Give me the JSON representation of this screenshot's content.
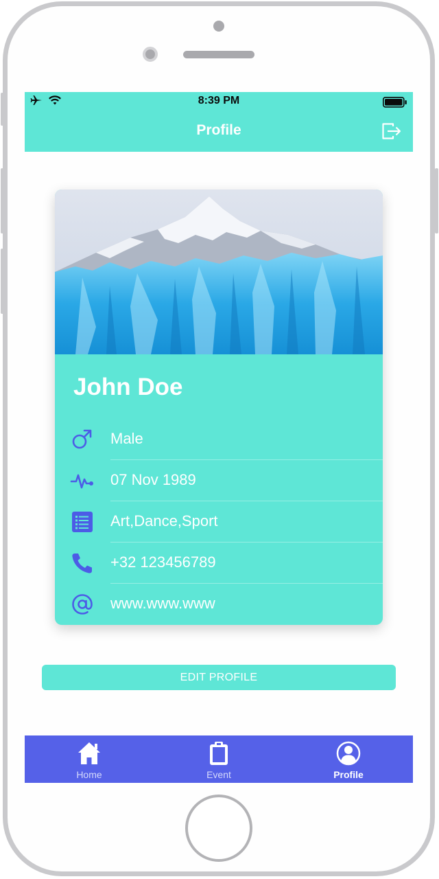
{
  "status_bar": {
    "time": "8:39 PM"
  },
  "header": {
    "title": "Profile",
    "logout_icon": "logout-icon"
  },
  "profile": {
    "name": "John Doe",
    "cover_image": "glacier-mountain-photo",
    "details": [
      {
        "icon": "male-icon",
        "value": "Male"
      },
      {
        "icon": "heartbeat-icon",
        "value": "07 Nov 1989"
      },
      {
        "icon": "list-icon",
        "value": "Art,Dance,Sport"
      },
      {
        "icon": "phone-icon",
        "value": "+32 123456789"
      },
      {
        "icon": "at-icon",
        "value": "www.www.www"
      }
    ]
  },
  "edit_button": {
    "label": "EDIT PROFILE"
  },
  "tab_bar": {
    "tabs": [
      {
        "label": "Home",
        "icon": "home-icon",
        "active": false
      },
      {
        "label": "Event",
        "icon": "clipboard-icon",
        "active": false
      },
      {
        "label": "Profile",
        "icon": "profile-icon",
        "active": true
      }
    ]
  },
  "colors": {
    "accent": "#5ee6d6",
    "tab_bar": "#5561e8",
    "icon": "#4c5ce6",
    "text_on_accent": "#ffffff"
  }
}
